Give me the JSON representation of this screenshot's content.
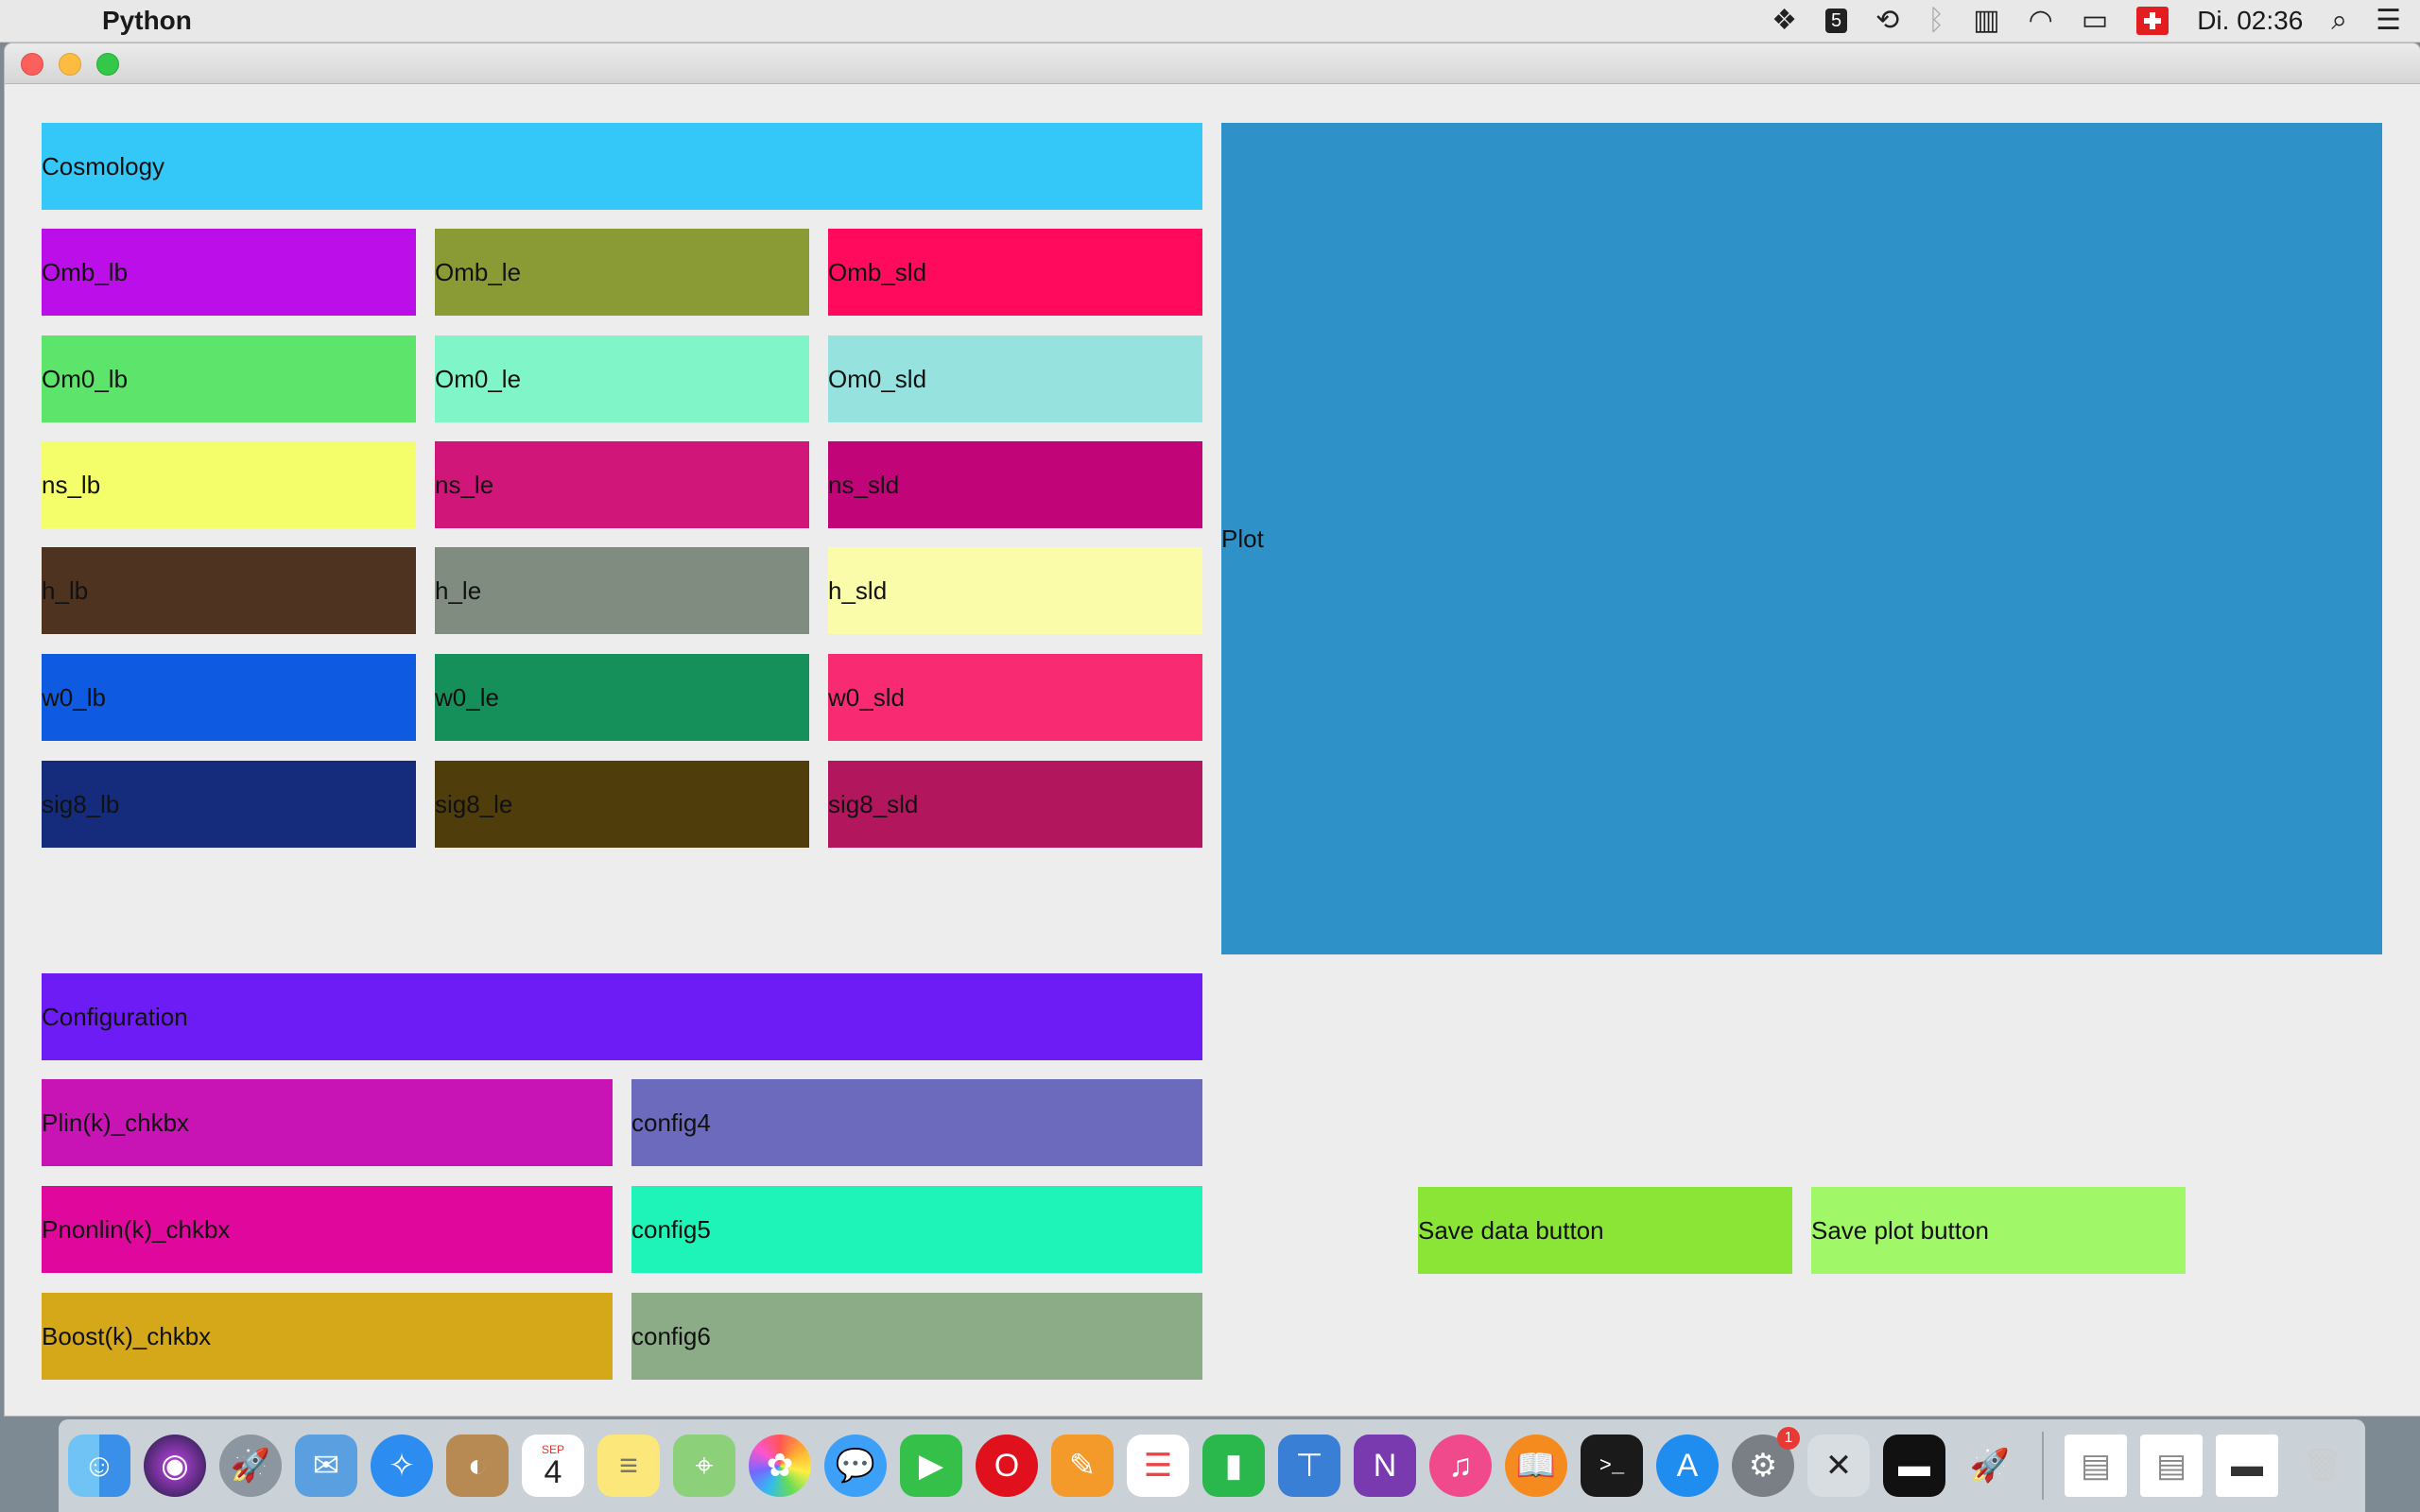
{
  "menubar": {
    "app_name": "Python",
    "clock": "Di. 02:36",
    "icons": [
      "dropbox-icon",
      "badge-5-icon",
      "time-machine-icon",
      "bluetooth-icon",
      "battery-box-icon",
      "wifi-icon",
      "battery-icon",
      "swiss-flag-icon",
      "search-icon",
      "menu-list-icon"
    ],
    "badge_5": "5"
  },
  "window": {
    "cosmology_header": "Cosmology",
    "param_rows": [
      [
        "Omb_lb",
        "Omb_le",
        "Omb_sld"
      ],
      [
        "Om0_lb",
        "Om0_le",
        "Om0_sld"
      ],
      [
        "ns_lb",
        "ns_le",
        "ns_sld"
      ],
      [
        "h_lb",
        "h_le",
        "h_sld"
      ],
      [
        "w0_lb",
        "w0_le",
        "w0_sld"
      ],
      [
        "sig8_lb",
        "sig8_le",
        "sig8_sld"
      ]
    ],
    "param_colors": [
      [
        "#bb0ee8",
        "#8a9a34",
        "#ff0a5c"
      ],
      [
        "#5de46a",
        "#80f5c8",
        "#96e2de"
      ],
      [
        "#f3fe6a",
        "#d01678",
        "#c20479"
      ],
      [
        "#4e3420",
        "#808c80",
        "#fafcaa"
      ],
      [
        "#0e5ae0",
        "#16905a",
        "#f82a72"
      ],
      [
        "#152c7c",
        "#503d0c",
        "#b2165c"
      ]
    ],
    "cosmology_color": "#34c8f8",
    "configuration_header": "Configuration",
    "configuration_color": "#6d1cf5",
    "config_rows": [
      [
        "Plin(k)_chkbx",
        "config4"
      ],
      [
        "Pnonlin(k)_chkbx",
        "config5"
      ],
      [
        "Boost(k)_chkbx",
        "config6"
      ]
    ],
    "config_colors": [
      [
        "#c814b4",
        "#6c6abc"
      ],
      [
        "#e0079c",
        "#1ef4b8"
      ],
      [
        "#d4a818",
        "#8cac88"
      ]
    ],
    "plot_label": "Plot",
    "plot_color": "#2e92c8",
    "save_data_label": "Save data button",
    "save_data_color": "#8ae536",
    "save_plot_label": "Save plot button",
    "save_plot_color": "#a0f868"
  },
  "dock": {
    "apps": [
      "finder",
      "siri",
      "launchpad",
      "mail",
      "safari",
      "contacts",
      "calendar",
      "notes",
      "maps",
      "photos",
      "messages",
      "facetime",
      "opera",
      "pages",
      "reminders",
      "numbers",
      "keynote",
      "onenote",
      "itunes",
      "ibooks",
      "terminal",
      "app-store",
      "system-preferences",
      "xquartz",
      "preview-screen",
      "python-rocket"
    ],
    "calendar_month": "SEP",
    "calendar_day": "4",
    "sysprefs_badge": "1",
    "docs": [
      "document-1",
      "document-2",
      "document-3",
      "trash"
    ]
  }
}
